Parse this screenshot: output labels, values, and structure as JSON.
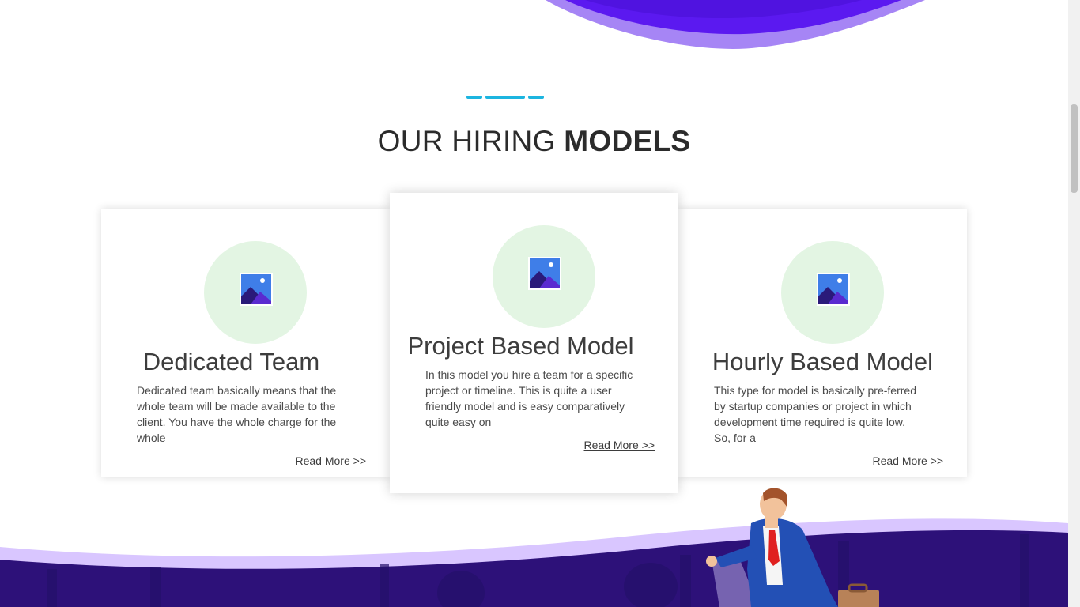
{
  "colors": {
    "accent": "#1cb5e0",
    "wave_dark": "#5b19f0",
    "wave_light": "#a685f5",
    "icon_bg": "#e3f5e3",
    "scene_dark": "#2d1179",
    "scene_light": "#d9c6ff"
  },
  "section": {
    "title_light": "OUR HIRING ",
    "title_bold": "MODELS"
  },
  "cards": [
    {
      "icon": "image-icon",
      "title": "Dedicated Team",
      "text": "Dedicated team basically means that the whole team will be made available to the client. You have the whole charge for the whole",
      "link": "Read More >>"
    },
    {
      "icon": "image-icon",
      "title": "Project Based Model",
      "text": "In this model you hire a team for a specific project or timeline. This is quite a user friendly model and is easy comparatively quite easy on",
      "link": "Read More >>"
    },
    {
      "icon": "image-icon",
      "title": "Hourly Based Model",
      "text": "This type for model is basically pre-ferred by startup companies or project in which development time required is quite low. So, for a",
      "link": "Read More >>"
    }
  ]
}
